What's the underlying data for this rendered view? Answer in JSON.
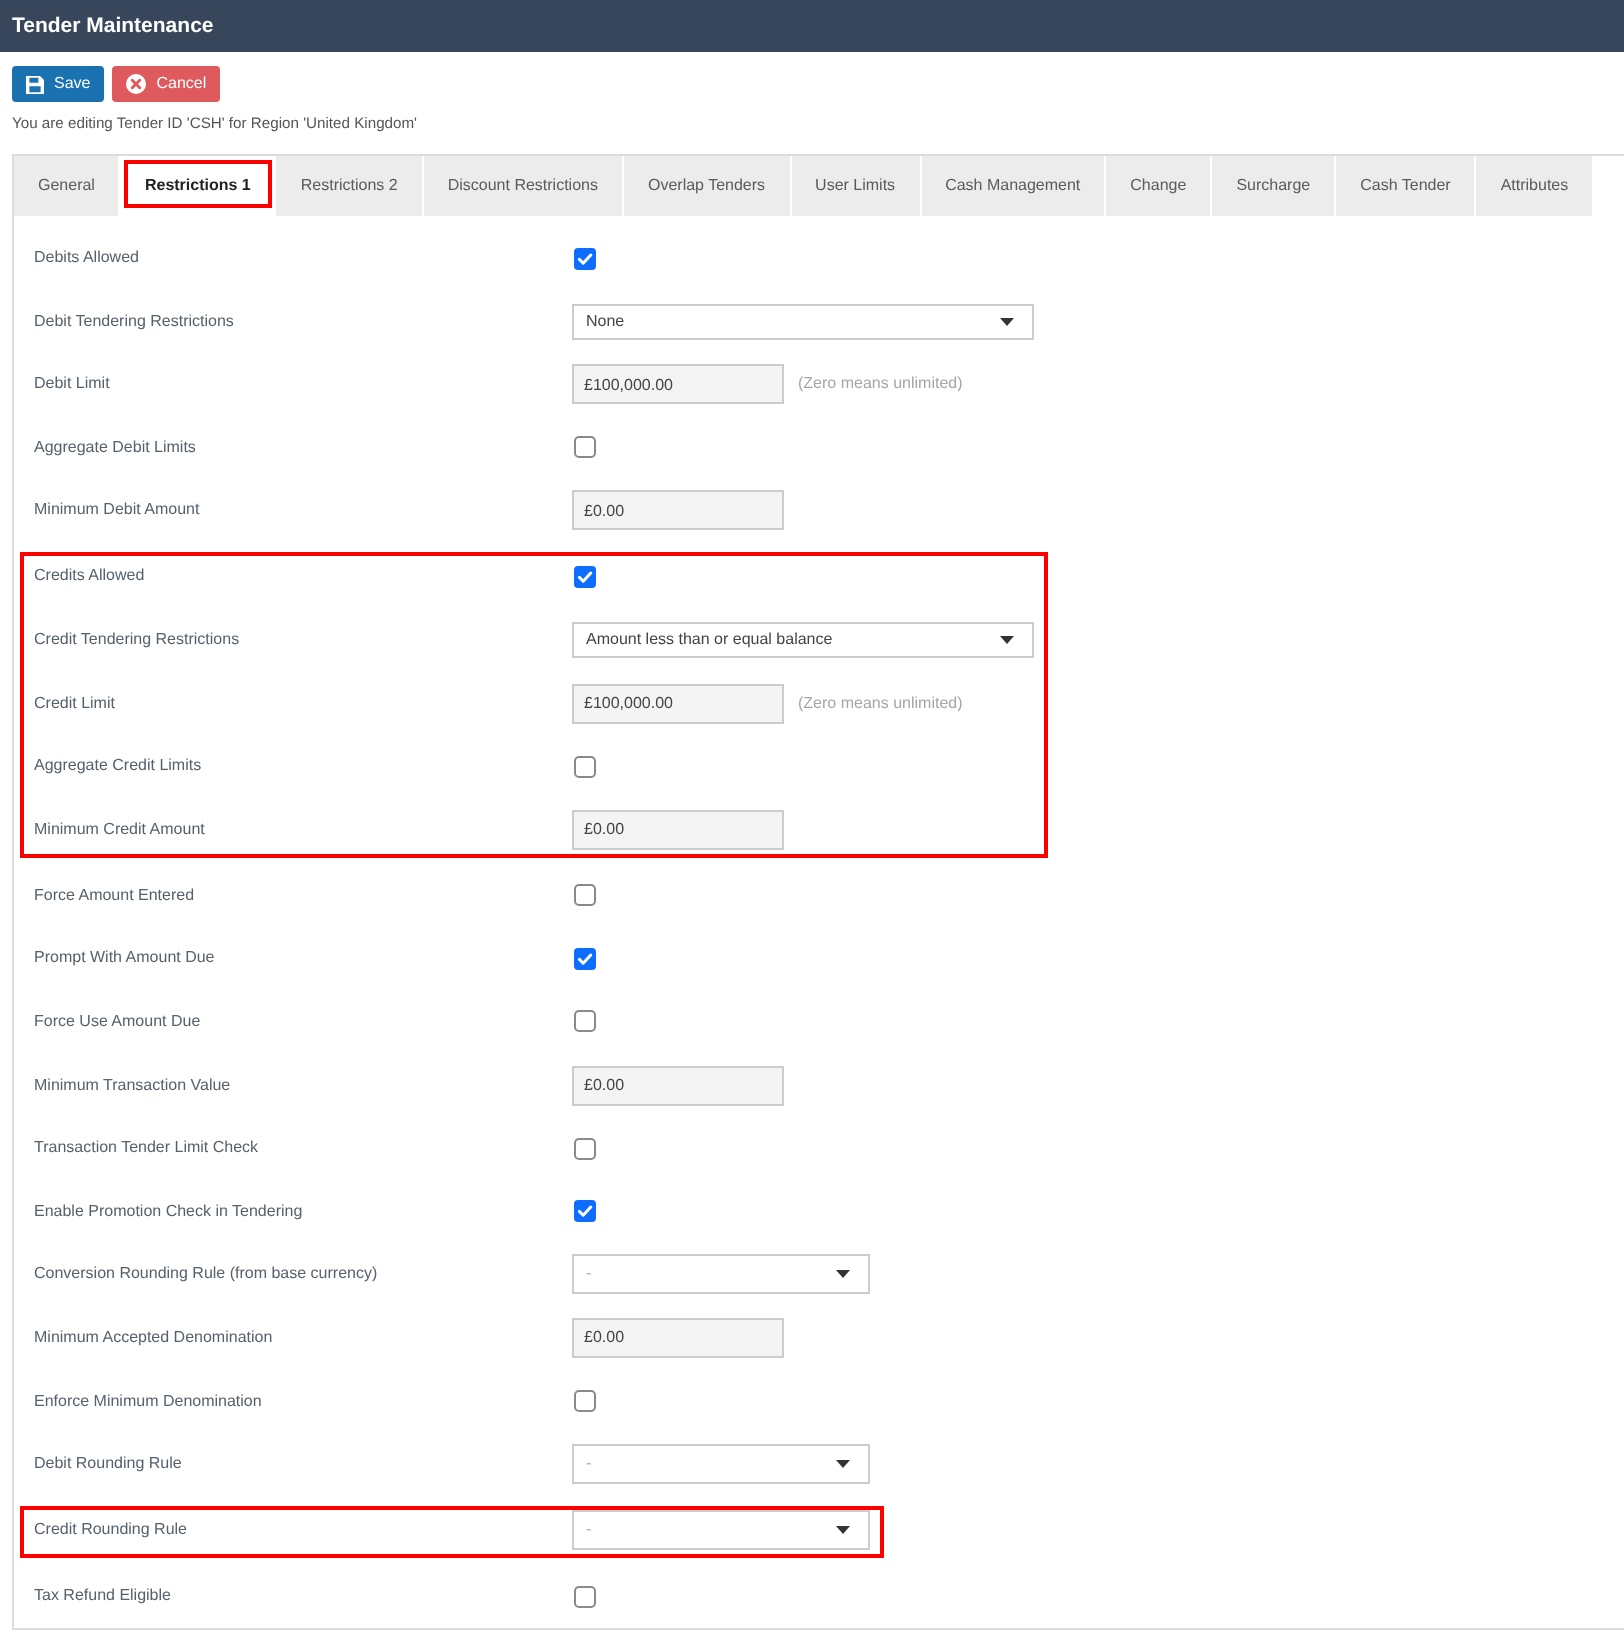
{
  "window": {
    "title": "Tender Maintenance"
  },
  "toolbar": [
    {
      "kind": "save",
      "label": "Save"
    },
    {
      "kind": "cancel",
      "label": "Cancel"
    }
  ],
  "info": "You are editing Tender ID 'CSH' for Region 'United Kingdom'",
  "tabs": [
    {
      "label": "General",
      "selected": false,
      "highlighted": false
    },
    {
      "label": "Restrictions 1",
      "selected": true,
      "highlighted": true
    },
    {
      "label": "Restrictions 2",
      "selected": false,
      "highlighted": false
    },
    {
      "label": "Discount Restrictions",
      "selected": false,
      "highlighted": false
    },
    {
      "label": "Overlap Tenders",
      "selected": false,
      "highlighted": false
    },
    {
      "label": "User Limits",
      "selected": false,
      "highlighted": false
    },
    {
      "label": "Cash Management",
      "selected": false,
      "highlighted": false
    },
    {
      "label": "Change",
      "selected": false,
      "highlighted": false
    },
    {
      "label": "Surcharge",
      "selected": false,
      "highlighted": false
    },
    {
      "label": "Cash Tender",
      "selected": false,
      "highlighted": false
    },
    {
      "label": "Attributes",
      "selected": false,
      "highlighted": false
    }
  ],
  "form_groups": [
    {
      "highlighted": false,
      "fields": [
        {
          "kind": "checkbox",
          "label": "Debits Allowed",
          "checked": true
        },
        {
          "kind": "select",
          "label": "Debit Tendering Restrictions",
          "value": "None"
        },
        {
          "kind": "text",
          "label": "Debit Limit",
          "value": "£100,000.00",
          "hint": "(Zero means unlimited)"
        },
        {
          "kind": "checkbox",
          "label": "Aggregate Debit Limits",
          "checked": false
        },
        {
          "kind": "text",
          "label": "Minimum Debit Amount",
          "value": "£0.00"
        }
      ]
    },
    {
      "highlighted": true,
      "fields": [
        {
          "kind": "checkbox",
          "label": "Credits Allowed",
          "checked": true
        },
        {
          "kind": "select",
          "label": "Credit Tendering Restrictions",
          "value": "Amount less than or equal balance"
        },
        {
          "kind": "text",
          "label": "Credit Limit",
          "value": "£100,000.00",
          "hint": "(Zero means unlimited)"
        },
        {
          "kind": "checkbox",
          "label": "Aggregate Credit Limits",
          "checked": false
        },
        {
          "kind": "text",
          "label": "Minimum Credit Amount",
          "value": "£0.00"
        }
      ]
    },
    {
      "highlighted": false,
      "fields": [
        {
          "kind": "checkbox",
          "label": "Force Amount Entered",
          "checked": false
        },
        {
          "kind": "checkbox",
          "label": "Prompt With Amount Due",
          "checked": true
        },
        {
          "kind": "checkbox",
          "label": "Force Use Amount Due",
          "checked": false
        },
        {
          "kind": "text",
          "label": "Minimum Transaction Value",
          "value": "£0.00"
        },
        {
          "kind": "checkbox",
          "label": "Transaction Tender Limit Check",
          "checked": false
        },
        {
          "kind": "checkbox",
          "label": "Enable Promotion Check in Tendering",
          "checked": true
        },
        {
          "kind": "select",
          "label": "Conversion Rounding Rule (from base currency)",
          "placeholder": "-"
        },
        {
          "kind": "text",
          "label": "Minimum Accepted Denomination",
          "value": "£0.00"
        },
        {
          "kind": "checkbox",
          "label": "Enforce Minimum Denomination",
          "checked": false
        },
        {
          "kind": "select",
          "label": "Debit Rounding Rule",
          "placeholder": "-"
        }
      ]
    },
    {
      "highlighted": true,
      "fields": [
        {
          "kind": "select",
          "label": "Credit Rounding Rule",
          "placeholder": "-"
        }
      ]
    },
    {
      "highlighted": false,
      "fields": [
        {
          "kind": "checkbox",
          "label": "Tax Refund Eligible",
          "checked": false
        }
      ]
    }
  ]
}
